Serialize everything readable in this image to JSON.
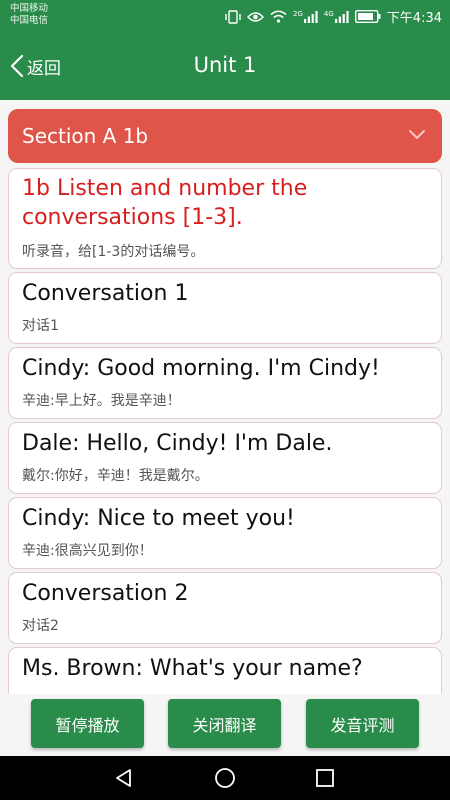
{
  "status_bar": {
    "carrier_1": "中国移动",
    "carrier_2": "中国电信",
    "net_1": "2G",
    "net_2": "4G",
    "time": "下午4:34"
  },
  "app_bar": {
    "back_label": "返回",
    "title": "Unit 1"
  },
  "section": {
    "title": "Section A 1b"
  },
  "items": [
    {
      "en": "1b Listen and number the conversations [1-3].",
      "zh": "听录音，给[1-3的对话编号。"
    },
    {
      "en": "Conversation 1",
      "zh": "对话1"
    },
    {
      "en": "Cindy: Good morning. I'm Cindy!",
      "zh": "辛迪:早上好。我是辛迪！"
    },
    {
      "en": "Dale: Hello, Cindy! I'm Dale.",
      "zh": "戴尔:你好，辛迪！我是戴尔。"
    },
    {
      "en": "Cindy: Nice to meet you!",
      "zh": "辛迪:很高兴见到你！"
    },
    {
      "en": "Conversation 2",
      "zh": "对话2"
    },
    {
      "en": "Ms. Brown: What's your name?"
    }
  ],
  "actions": {
    "pause_label": "暂停播放",
    "close_translation_label": "关闭翻译",
    "pronunciation_label": "发音评测"
  },
  "colors": {
    "primary": "#2a8c4a",
    "section_header": "#e0554a",
    "title_red": "#d81e1e"
  }
}
